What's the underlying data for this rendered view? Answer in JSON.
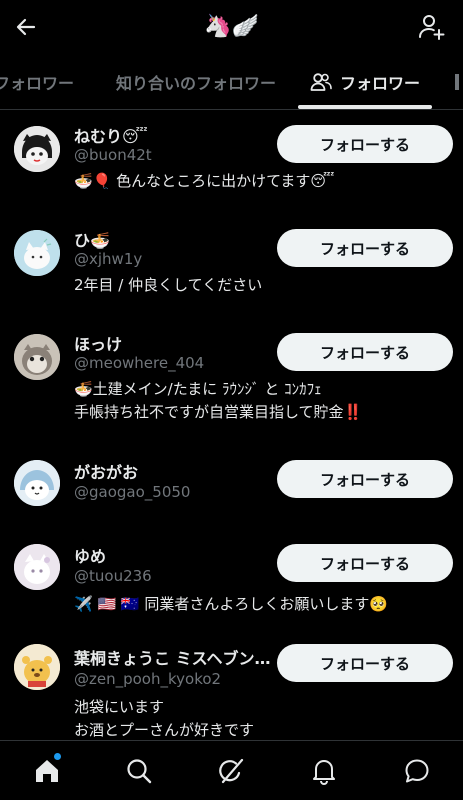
{
  "header": {
    "title": "🦄🪽",
    "back_icon": "arrow-left-icon",
    "add_icon": "person-add-icon"
  },
  "tabs": [
    {
      "label": "フォロワー",
      "active": false
    },
    {
      "label": "知り合いのフォロワー",
      "active": false
    },
    {
      "label": "フォロワー",
      "active": true,
      "icon": "people-icon"
    }
  ],
  "follow_label": "フォローする",
  "users": [
    {
      "name": "ねむり😴",
      "handle": "@buon42t",
      "bio": "🍜🎈 色んなところに出かけてます😴"
    },
    {
      "name": "ひ🍜",
      "handle": "@xjhw1y",
      "bio": "2年目 / 仲良くしてください"
    },
    {
      "name": "ほっけ",
      "handle": "@meowhere_404",
      "bio": "🍜土建メイン/たまに ﾗｳﾝｼﾞ と ｺﾝｶﾌｪ\n手帳持ち社不ですが自営業目指して貯金‼️"
    },
    {
      "name": "がおがお",
      "handle": "@gaogao_5050",
      "bio": ""
    },
    {
      "name": "ゆめ",
      "handle": "@tuou236",
      "bio": "✈️ 🇺🇸 🇦🇺 同業者さんよろしくお願いします🥺"
    },
    {
      "name": "葉桐きょうこ ミスヘブン…",
      "handle": "@zen_pooh_kyoko2",
      "bio": "池袋にいます\nお酒とプーさんが好きです"
    }
  ],
  "bottom_nav": [
    "home-icon",
    "search-icon",
    "grok-icon",
    "notifications-icon",
    "messages-icon"
  ],
  "colors": {
    "accent": "#1d9bf0",
    "button_bg": "#eff3f4",
    "muted": "#71767b"
  }
}
